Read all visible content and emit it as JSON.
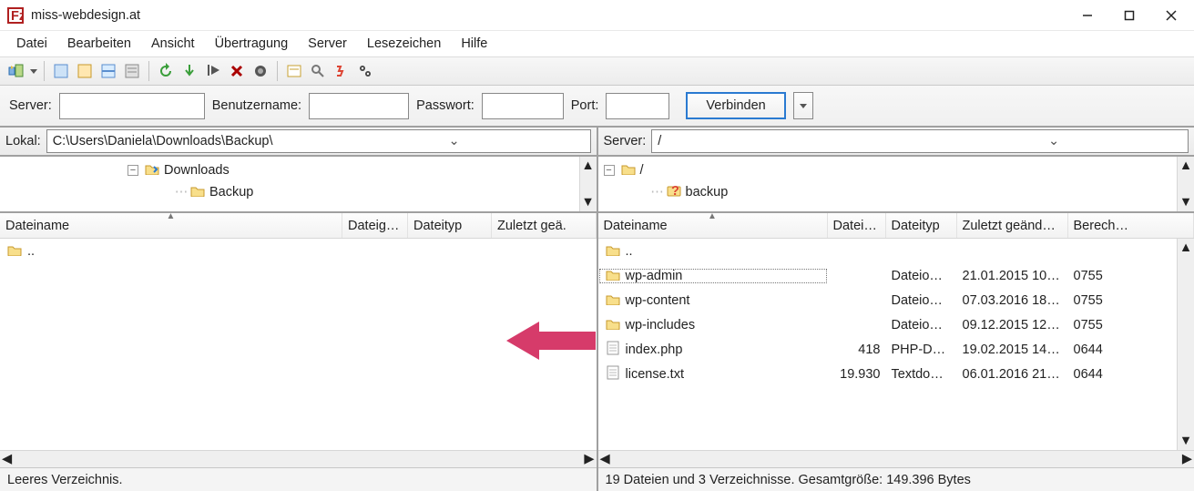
{
  "title": "miss-webdesign.at",
  "menubar": [
    "Datei",
    "Bearbeiten",
    "Ansicht",
    "Übertragung",
    "Server",
    "Lesezeichen",
    "Hilfe"
  ],
  "quickbar": {
    "server_label": "Server:",
    "user_label": "Benutzername:",
    "pass_label": "Passwort:",
    "port_label": "Port:",
    "connect": "Verbinden",
    "server": "",
    "user": "",
    "pass": "",
    "port": ""
  },
  "local": {
    "path_label": "Lokal:",
    "path": "C:\\Users\\Daniela\\Downloads\\Backup\\",
    "tree": [
      {
        "indent": 140,
        "exp": "-",
        "icon": "📁",
        "label": "Downloads",
        "accent": "#2a7ad1"
      },
      {
        "indent": 190,
        "exp": "",
        "icon": "📁",
        "label": "Backup",
        "accent": "#d9b84a"
      }
    ],
    "cols": [
      "Dateiname",
      "Dateig…",
      "Dateityp",
      "Zuletzt geä."
    ],
    "rows": [
      {
        "icon": "📁",
        "name": "..",
        "sel": false
      }
    ],
    "status": "Leeres Verzeichnis."
  },
  "remote": {
    "path_label": "Server:",
    "path": "/",
    "tree": [
      {
        "indent": 6,
        "exp": "-",
        "icon": "📁",
        "label": "/",
        "accent": "#d9b84a"
      },
      {
        "indent": 56,
        "exp": "",
        "icon": "❓",
        "label": "backup",
        "accent": "#d43"
      }
    ],
    "cols": [
      "Dateiname",
      "Datei…",
      "Dateityp",
      "Zuletzt geänd…",
      "Berech…"
    ],
    "rows": [
      {
        "icon": "📁",
        "name": "..",
        "sel": false
      },
      {
        "icon": "📁",
        "name": "wp-admin",
        "size": "",
        "type": "Dateio…",
        "mod": "21.01.2015 10…",
        "perm": "0755",
        "sel": true
      },
      {
        "icon": "📁",
        "name": "wp-content",
        "size": "",
        "type": "Dateio…",
        "mod": "07.03.2016 18…",
        "perm": "0755"
      },
      {
        "icon": "📁",
        "name": "wp-includes",
        "size": "",
        "type": "Dateio…",
        "mod": "09.12.2015 12…",
        "perm": "0755"
      },
      {
        "icon": "📄",
        "name": "index.php",
        "size": "418",
        "type": "PHP-D…",
        "mod": "19.02.2015 14…",
        "perm": "0644"
      },
      {
        "icon": "📄",
        "name": "license.txt",
        "size": "19.930",
        "type": "Textdo…",
        "mod": "06.01.2016 21…",
        "perm": "0644"
      }
    ],
    "status": "19 Dateien und 3 Verzeichnisse. Gesamtgröße: 149.396 Bytes"
  },
  "toolbar_icons": [
    "site-manager-icon",
    "dropdown-icon",
    "|",
    "toggle-log-icon",
    "toggle-local-tree-icon",
    "toggle-remote-tree-icon",
    "toggle-queue-icon",
    "|",
    "refresh-icon",
    "process-queue-icon",
    "cancel-icon",
    "disconnect-icon",
    "reconnect-icon",
    "|",
    "filter-icon",
    "search-icon",
    "compare-icon",
    "sync-browse-icon"
  ]
}
